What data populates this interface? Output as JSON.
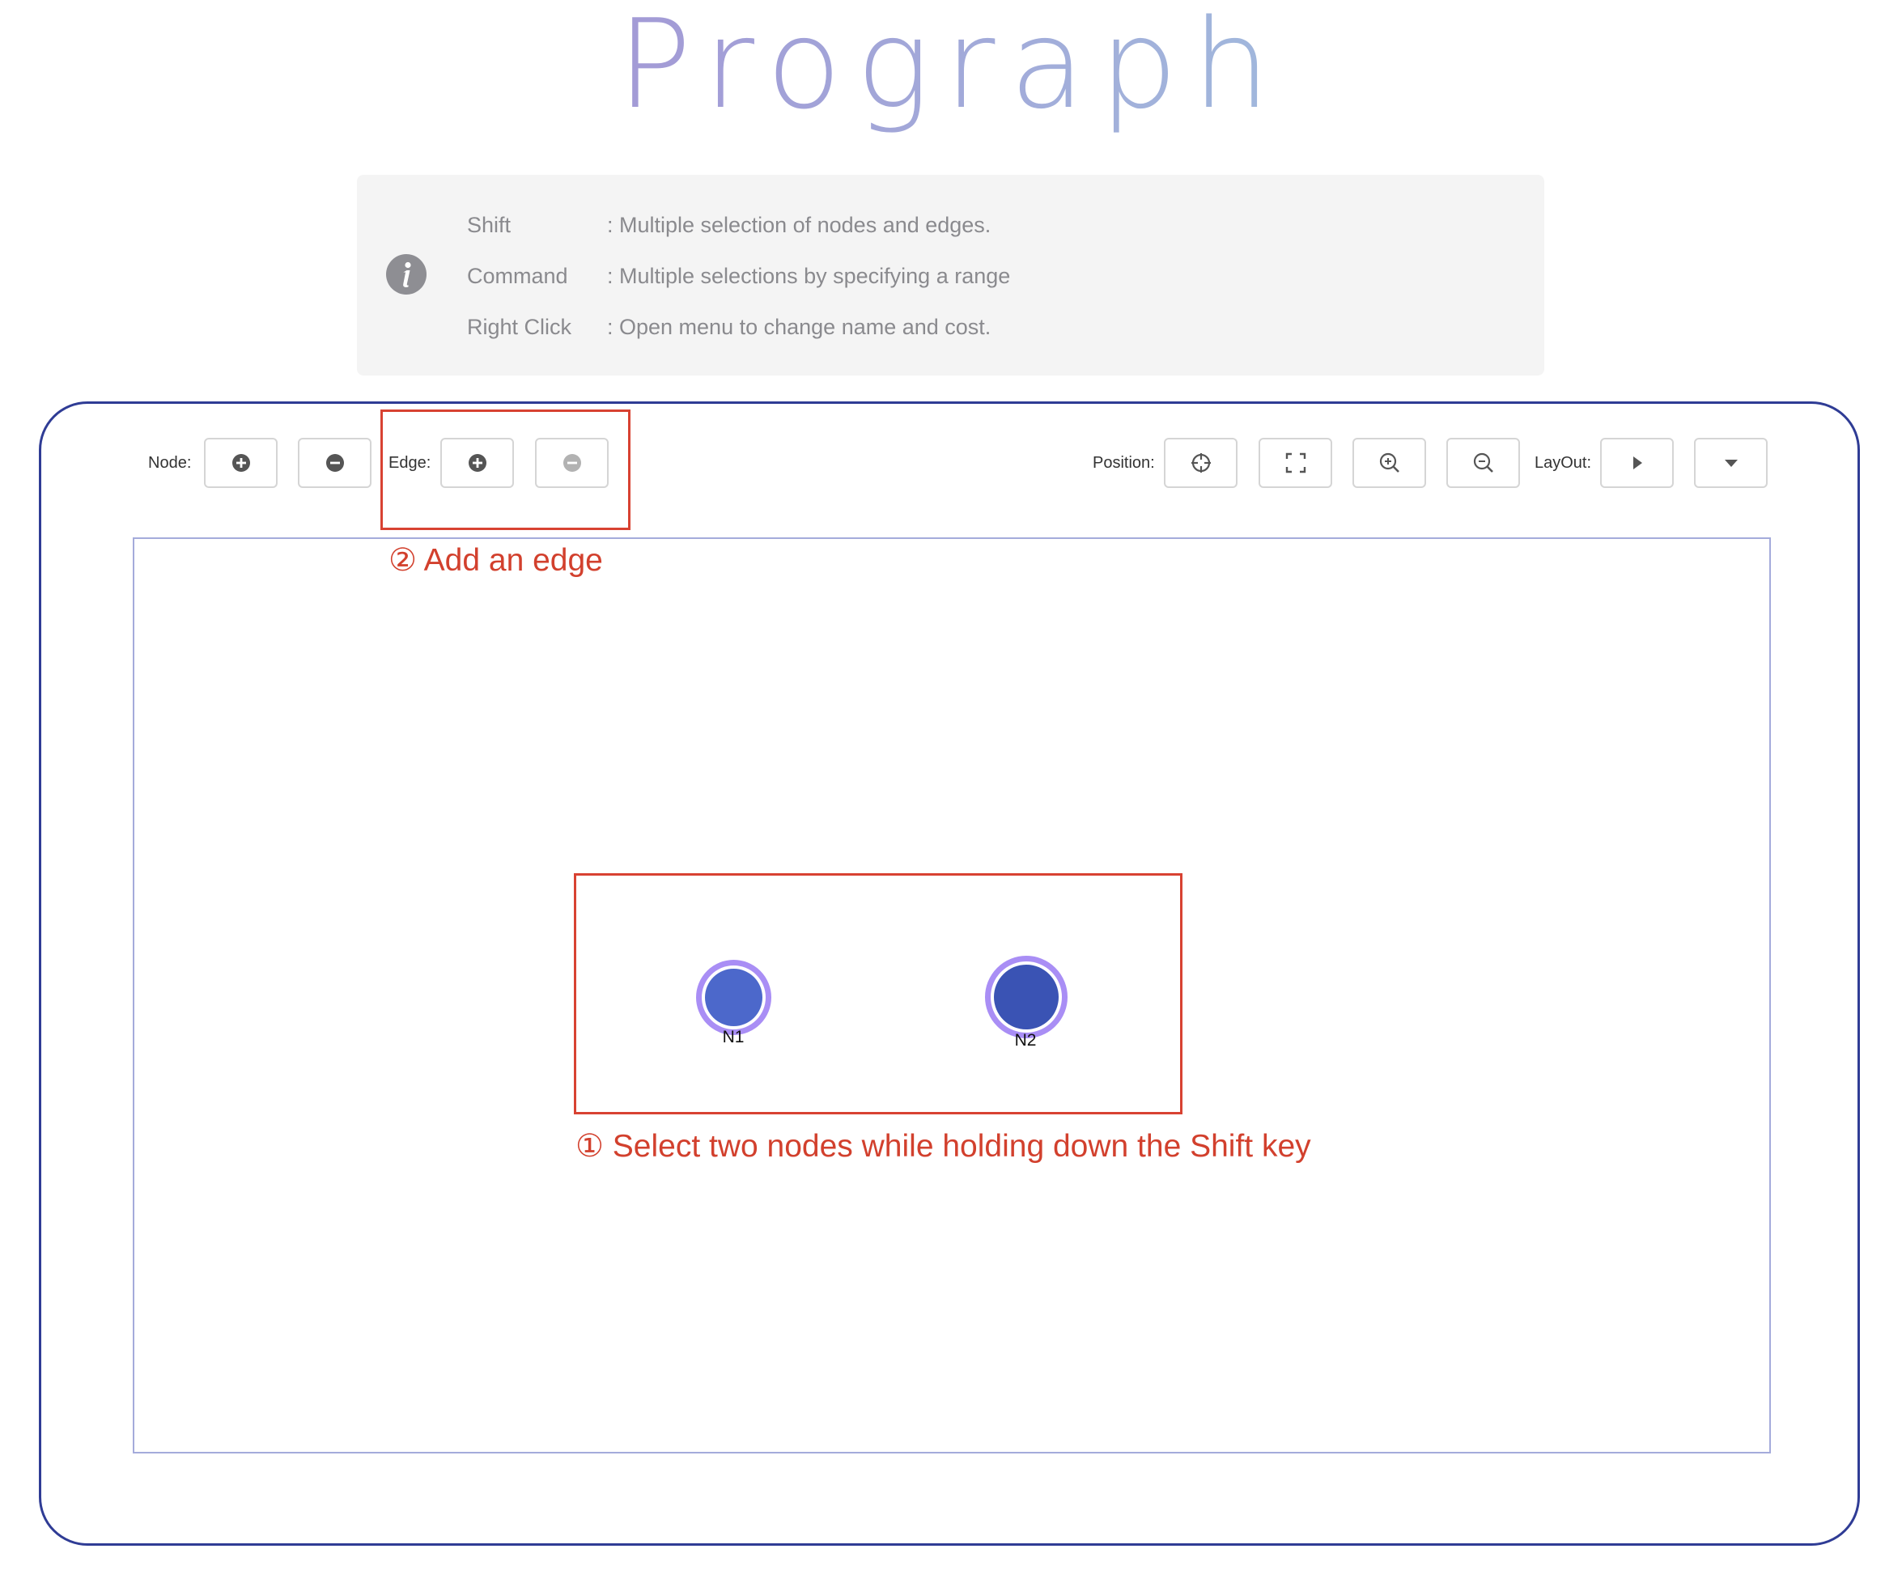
{
  "header": {
    "logo_text": "Prograph"
  },
  "info": {
    "icon": "info-icon",
    "rows": [
      {
        "key": "Shift",
        "desc": ": Multiple selection of nodes and edges."
      },
      {
        "key": "Command",
        "desc": ": Multiple selections by specifying a range"
      },
      {
        "key": "Right Click",
        "desc": ": Open menu to change name and cost."
      }
    ]
  },
  "toolbar": {
    "node_label": "Node:",
    "edge_label": "Edge:",
    "position_label": "Position:",
    "layout_label": "LayOut:",
    "node_add_icon": "plus-circle-icon",
    "node_remove_icon": "minus-circle-icon",
    "edge_add_icon": "plus-circle-icon",
    "edge_remove_icon": "minus-circle-icon",
    "edge_remove_disabled": true,
    "position_icons": [
      "crosshair-icon",
      "fit-screen-icon",
      "zoom-in-icon",
      "zoom-out-icon"
    ],
    "layout_icons": [
      "play-icon",
      "caret-down-icon"
    ]
  },
  "graph": {
    "nodes": [
      {
        "id": "N1",
        "label": "N1",
        "fill": "#4c68cb",
        "ring": "#a98ef5"
      },
      {
        "id": "N2",
        "label": "N2",
        "fill": "#3a53b4",
        "ring": "#a98ef5"
      }
    ]
  },
  "annotations": {
    "step2": "② Add an edge",
    "step1": "① Select two nodes while holding down the Shift key"
  },
  "colors": {
    "frame_border": "#2f3c95",
    "canvas_border": "#a4abdb",
    "annotation_red": "#d2402d",
    "logo_gradient_start": "#a39ad6",
    "logo_gradient_end": "#a1b8dc",
    "icon_dark": "#555555",
    "icon_disabled": "#b2b2b2"
  }
}
